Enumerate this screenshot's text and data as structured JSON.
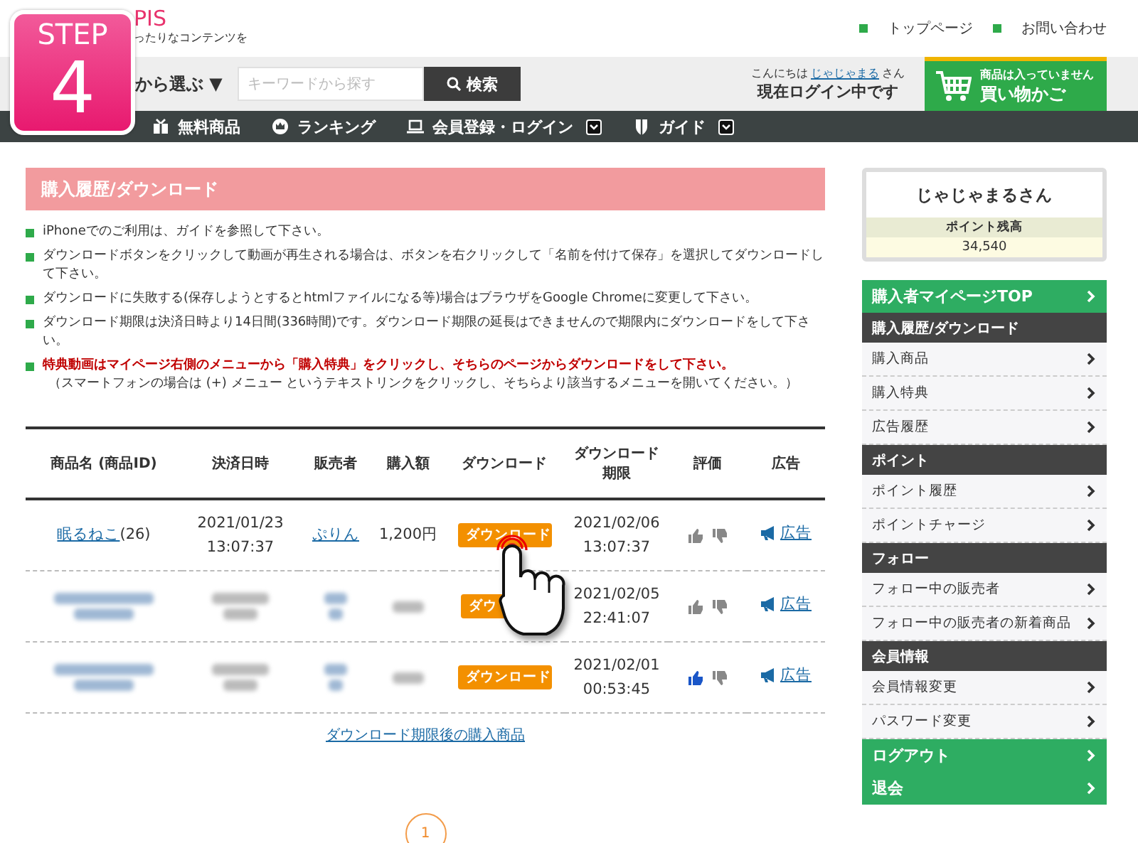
{
  "badge": {
    "label": "STEP",
    "number": "4"
  },
  "header": {
    "logo": "PIS",
    "tagline": "ったりなコンテンツを",
    "links": [
      "トップページ",
      "お問い合わせ"
    ]
  },
  "search_bar": {
    "category": "から選ぶ ▼",
    "placeholder": "キーワードから探す",
    "button": "検索",
    "greeting": "こんにちは",
    "user": "じゃじゃまる",
    "suffix": "さん",
    "status": "現在ログイン中です",
    "cart_note": "商品は入っていません",
    "cart_label": "買い物かご"
  },
  "nav": [
    {
      "label": "無料商品",
      "dropdown": false
    },
    {
      "label": "ランキング",
      "dropdown": false
    },
    {
      "label": "会員登録・ログイン",
      "dropdown": true
    },
    {
      "label": "ガイド",
      "dropdown": true
    }
  ],
  "title": "購入履歴/ダウンロード",
  "notices": [
    {
      "text": "iPhoneでのご利用は、ガイドを参照して下さい。",
      "emphasis": false
    },
    {
      "text": "ダウンロードボタンをクリックして動画が再生される場合は、ボタンを右クリックして「名前を付けて保存」を選択してダウンロードして下さい。",
      "emphasis": false
    },
    {
      "text": "ダウンロードに失敗する(保存しようとするとhtmlファイルになる等)場合はブラウザをGoogle Chromeに変更して下さい。",
      "emphasis": false
    },
    {
      "text": "ダウンロード期限は決済日時より14日間(336時間)です。ダウンロード期限の延長はできませんので期限内にダウンロードをして下さい。",
      "emphasis": false
    },
    {
      "text": "特典動画はマイページ右側のメニューから「購入特典」をクリックし、そちらのページからダウンロードをして下さい。",
      "emphasis": true,
      "note": "（スマートフォンの場合は (+) メニュー というテキストリンクをクリックし、そちらより該当するメニューを開いてください。）"
    }
  ],
  "table": {
    "columns": [
      "商品名 (商品ID)",
      "決済日時",
      "販売者",
      "購入額",
      "ダウンロード",
      "ダウンロード期限",
      "評価",
      "広告"
    ],
    "rows": [
      {
        "blurred": false,
        "name": "眠るねこ",
        "id": "(26)",
        "date": "2021/01/23",
        "time": "13:07:37",
        "seller": "ぷりん",
        "amount": "1,200円",
        "download": "ダウンロード",
        "deadline_date": "2021/02/06",
        "deadline_time": "13:07:37",
        "liked": false,
        "ad": "広告"
      },
      {
        "blurred": true,
        "download": "ダウ",
        "deadline_date": "2021/02/05",
        "deadline_time": "22:41:07",
        "liked": false,
        "ad": "広告"
      },
      {
        "blurred": true,
        "download": "ダウンロード",
        "deadline_date": "2021/02/01",
        "deadline_time": "00:53:45",
        "liked": true,
        "ad": "広告"
      }
    ]
  },
  "expired_link": "ダウンロード期限後の購入商品",
  "pagination": [
    {
      "label": "1",
      "selected": true
    }
  ],
  "user_card": {
    "name": "じゃじゃまるさん",
    "points_label": "ポイント残高",
    "points": "34,540"
  },
  "menu": [
    {
      "kind": "primary",
      "label": "購入者マイページTOP"
    },
    {
      "kind": "section",
      "label": "購入履歴/ダウンロード"
    },
    {
      "kind": "link",
      "label": "購入商品"
    },
    {
      "kind": "link",
      "label": "購入特典"
    },
    {
      "kind": "link",
      "label": "広告履歴"
    },
    {
      "kind": "section",
      "label": "ポイント"
    },
    {
      "kind": "link",
      "label": "ポイント履歴"
    },
    {
      "kind": "link",
      "label": "ポイントチャージ"
    },
    {
      "kind": "section",
      "label": "フォロー"
    },
    {
      "kind": "link",
      "label": "フォロー中の販売者"
    },
    {
      "kind": "link",
      "label": "フォロー中の販売者の新着商品"
    },
    {
      "kind": "section",
      "label": "会員情報"
    },
    {
      "kind": "link",
      "label": "会員情報変更"
    },
    {
      "kind": "link",
      "label": "パスワード変更"
    },
    {
      "kind": "primary",
      "label": "ログアウト"
    },
    {
      "kind": "primary",
      "label": "退会"
    }
  ]
}
